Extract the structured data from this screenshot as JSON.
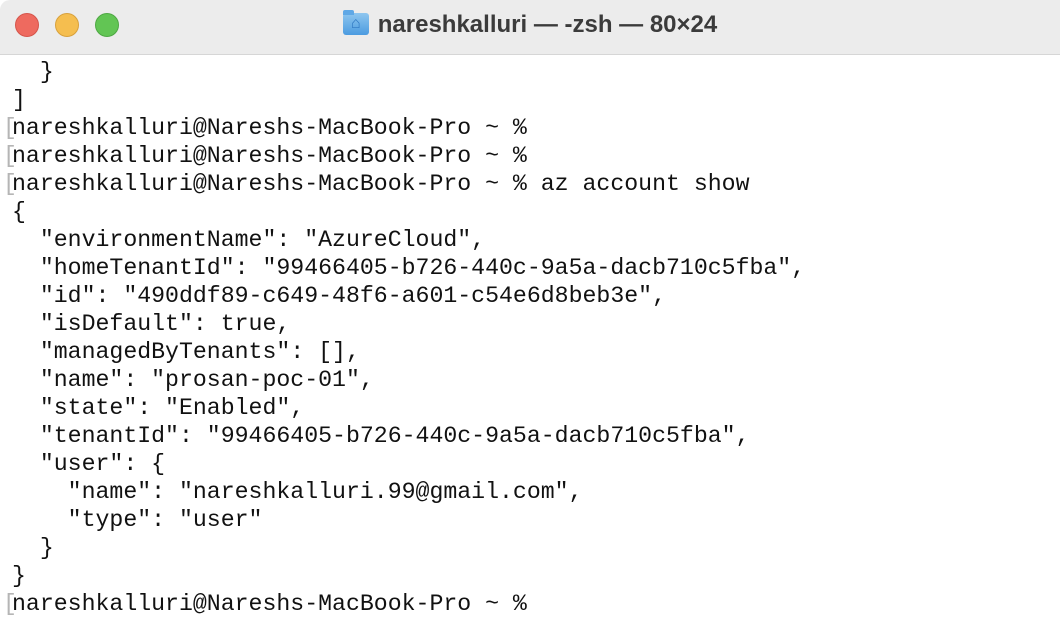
{
  "window": {
    "title": "nareshkalluri — -zsh — 80×24",
    "icon": "home-folder-icon"
  },
  "terminal": {
    "lines": [
      {
        "text": "  }",
        "marked": false
      },
      {
        "text": "]",
        "marked": false
      },
      {
        "text": "nareshkalluri@Nareshs-MacBook-Pro ~ %",
        "marked": true
      },
      {
        "text": "nareshkalluri@Nareshs-MacBook-Pro ~ %",
        "marked": true
      },
      {
        "text": "nareshkalluri@Nareshs-MacBook-Pro ~ % az account show",
        "marked": true
      },
      {
        "text": "{",
        "marked": false
      },
      {
        "text": "  \"environmentName\": \"AzureCloud\",",
        "marked": false
      },
      {
        "text": "  \"homeTenantId\": \"99466405-b726-440c-9a5a-dacb710c5fba\",",
        "marked": false
      },
      {
        "text": "  \"id\": \"490ddf89-c649-48f6-a601-c54e6d8beb3e\",",
        "marked": false
      },
      {
        "text": "  \"isDefault\": true,",
        "marked": false
      },
      {
        "text": "  \"managedByTenants\": [],",
        "marked": false
      },
      {
        "text": "  \"name\": \"prosan-poc-01\",",
        "marked": false
      },
      {
        "text": "  \"state\": \"Enabled\",",
        "marked": false
      },
      {
        "text": "  \"tenantId\": \"99466405-b726-440c-9a5a-dacb710c5fba\",",
        "marked": false
      },
      {
        "text": "  \"user\": {",
        "marked": false
      },
      {
        "text": "    \"name\": \"nareshkalluri.99@gmail.com\",",
        "marked": false
      },
      {
        "text": "    \"type\": \"user\"",
        "marked": false
      },
      {
        "text": "  }",
        "marked": false
      },
      {
        "text": "}",
        "marked": false
      },
      {
        "text": "nareshkalluri@Nareshs-MacBook-Pro ~ %",
        "marked": true
      }
    ]
  }
}
